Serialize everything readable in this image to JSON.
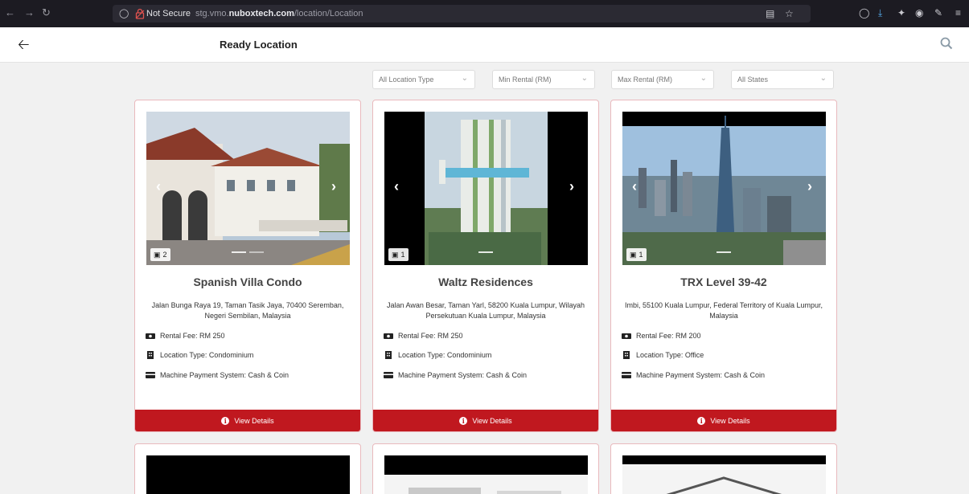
{
  "browser": {
    "not_secure": "Not Secure",
    "url_prefix": "stg.vmo.",
    "url_domain": "nuboxtech.com",
    "url_path": "/location/Location"
  },
  "header": {
    "title": "Ready Location"
  },
  "filters": [
    {
      "label": "All Location Type"
    },
    {
      "label": "Min Rental (RM)"
    },
    {
      "label": "Max Rental (RM)"
    },
    {
      "label": "All States"
    }
  ],
  "cards": [
    {
      "title": "Spanish Villa Condo",
      "address": "Jalan Bunga Raya 19, Taman Tasik Jaya, 70400 Seremban, Negeri Sembilan, Malaysia",
      "photo_count": "2",
      "rental": "Rental Fee: RM 250",
      "location_type": "Location Type: Condominium",
      "payment": "Machine Payment System: Cash & Coin",
      "button": "View Details"
    },
    {
      "title": "Waltz Residences",
      "address": "Jalan Awan Besar, Taman Yarl, 58200 Kuala Lumpur, Wilayah Persekutuan Kuala Lumpur, Malaysia",
      "photo_count": "1",
      "rental": "Rental Fee: RM 250",
      "location_type": "Location Type: Condominium",
      "payment": "Machine Payment System: Cash & Coin",
      "button": "View Details"
    },
    {
      "title": "TRX Level 39-42",
      "address": "Imbi, 55100 Kuala Lumpur, Federal Territory of Kuala Lumpur, Malaysia",
      "photo_count": "1",
      "rental": "Rental Fee: RM 200",
      "location_type": "Location Type: Office",
      "payment": "Machine Payment System: Cash & Coin",
      "button": "View Details"
    }
  ],
  "colors": {
    "accent": "#c0181f",
    "card_border": "#e9b9bd"
  }
}
